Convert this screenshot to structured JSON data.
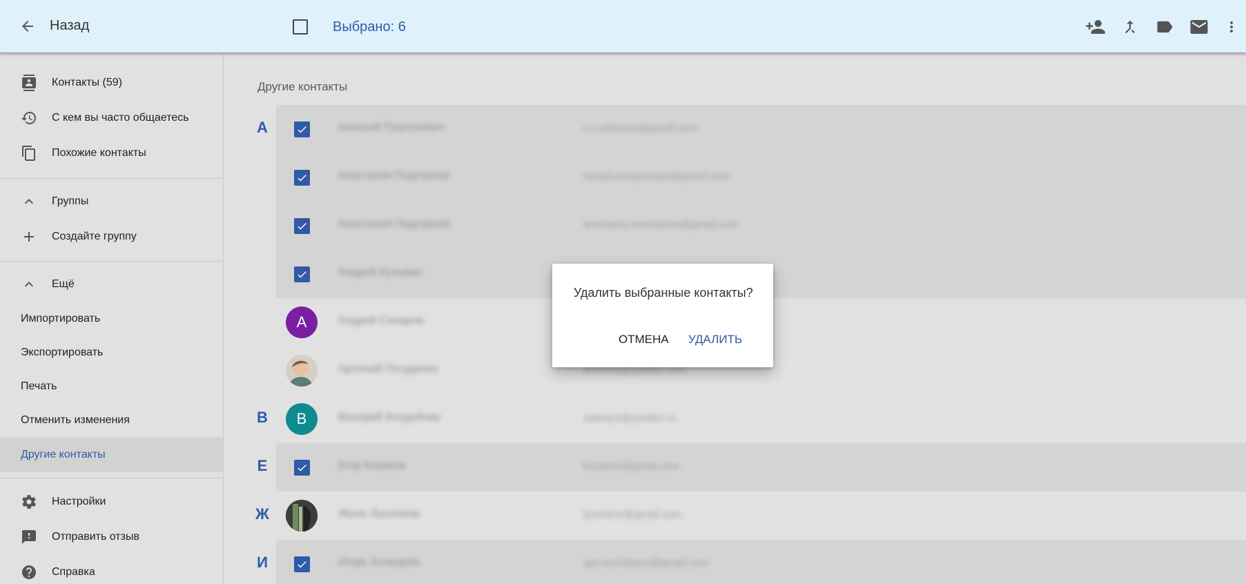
{
  "topbar": {
    "back_label": "Назад",
    "selected_text": "Выбрано: 6",
    "icons": [
      "add-to-contacts-icon",
      "merge-icon",
      "label-icon",
      "email-icon",
      "more-vert-icon"
    ]
  },
  "sidebar": {
    "contacts": "Контакты (59)",
    "frequent": "С кем вы часто общаетесь",
    "duplicates": "Похожие контакты",
    "groups": "Группы",
    "create_group": "Создайте группу",
    "more": "Ещё",
    "import": "Импортировать",
    "export": "Экспортировать",
    "print": "Печать",
    "undo": "Отменить изменения",
    "other": "Другие контакты",
    "settings": "Настройки",
    "feedback": "Отправить отзыв",
    "help": "Справка"
  },
  "main": {
    "section_title": "Другие контакты",
    "rows": [
      {
        "letter": "А",
        "state": "checked",
        "name": "Алексей Платонович",
        "email": "a.s.platonov@gmail.com"
      },
      {
        "letter": "",
        "state": "checked",
        "name": "Анастасия Подгорная",
        "email": "nastya.podgornaya@gmail.com"
      },
      {
        "letter": "",
        "state": "checked",
        "name": "Анастасия Подгорная",
        "email": "anastasia.samoylova@gmail.com"
      },
      {
        "letter": "",
        "state": "checked",
        "name": "Андрей Кузьмин",
        "email": ""
      },
      {
        "letter": "",
        "state": "avatar",
        "avatar_letter": "А",
        "avatar_color": "#7b1fa2",
        "name": "Андрей Сахаров",
        "email": ""
      },
      {
        "letter": "",
        "state": "photo",
        "name": "Арсений Погуденко",
        "email": "arsenos@yandex.com"
      },
      {
        "letter": "В",
        "state": "avatar",
        "avatar_letter": "В",
        "avatar_color": "#0f8a8f",
        "name": "Валерий Колдобчик",
        "email": "valeriy.k@yandex.ru"
      },
      {
        "letter": "Е",
        "state": "checked",
        "name": "Егор Казаков",
        "email": "kazakov@gmail.com"
      },
      {
        "letter": "Ж",
        "state": "photo2",
        "name": "Женя Лысенков",
        "email": "lysenkov@gmail.com"
      },
      {
        "letter": "И",
        "state": "checked",
        "name": "Игорь Бочкарёв",
        "email": "igor.bochkarev@gmail.com"
      }
    ]
  },
  "dialog": {
    "message": "Удалить выбранные контакты?",
    "cancel": "ОТМЕНА",
    "confirm": "УДАЛИТЬ"
  },
  "colors": {
    "accent": "#2f5aa6",
    "topbar_bg": "#dff2fc",
    "page_bg": "#e1e1e1"
  }
}
